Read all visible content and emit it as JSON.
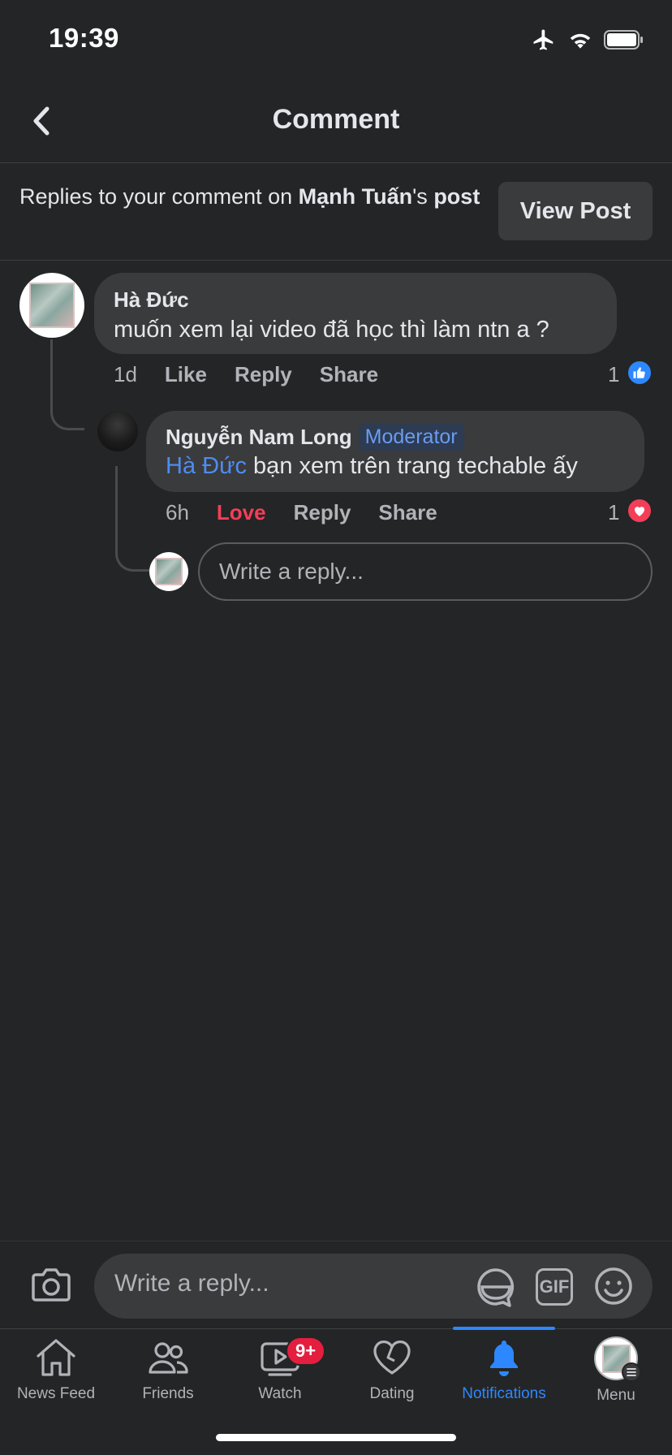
{
  "status_bar": {
    "time": "19:39"
  },
  "header": {
    "title": "Comment"
  },
  "context_bar": {
    "prefix": "Replies to your comment on ",
    "post_owner": "Mạnh Tuấn",
    "suffix": "'s ",
    "post_word": "post",
    "view_post_label": "View Post"
  },
  "comments": [
    {
      "author": "Hà Đức",
      "text": "muốn xem lại video đã học thì làm ntn a ?",
      "time": "1d",
      "actions": [
        "Like",
        "Reply",
        "Share"
      ],
      "reaction_count": "1",
      "reaction": "like-icon"
    },
    {
      "author": "Nguyễn Nam Long",
      "badge": "Moderator",
      "mention": "Hà Đức",
      "text": " bạn xem trên trang techable ấy",
      "time": "6h",
      "actions": [
        "Love",
        "Reply",
        "Share"
      ],
      "reaction_count": "1",
      "reaction": "love-icon"
    }
  ],
  "inline_reply": {
    "placeholder": "Write a reply..."
  },
  "composer": {
    "placeholder": "Write a reply...",
    "gif_label": "GIF"
  },
  "tabs": [
    {
      "label": "News Feed",
      "icon": "home-icon"
    },
    {
      "label": "Friends",
      "icon": "friends-icon"
    },
    {
      "label": "Watch",
      "icon": "watch-icon",
      "badge": "9+"
    },
    {
      "label": "Dating",
      "icon": "heart-icon"
    },
    {
      "label": "Notifications",
      "icon": "bell-icon",
      "active": true
    },
    {
      "label": "Menu",
      "icon": "profile-avatar"
    }
  ],
  "colors": {
    "accent": "#2d88ff",
    "love": "#f33e58",
    "background": "#242526",
    "bubble": "#3a3b3c"
  }
}
